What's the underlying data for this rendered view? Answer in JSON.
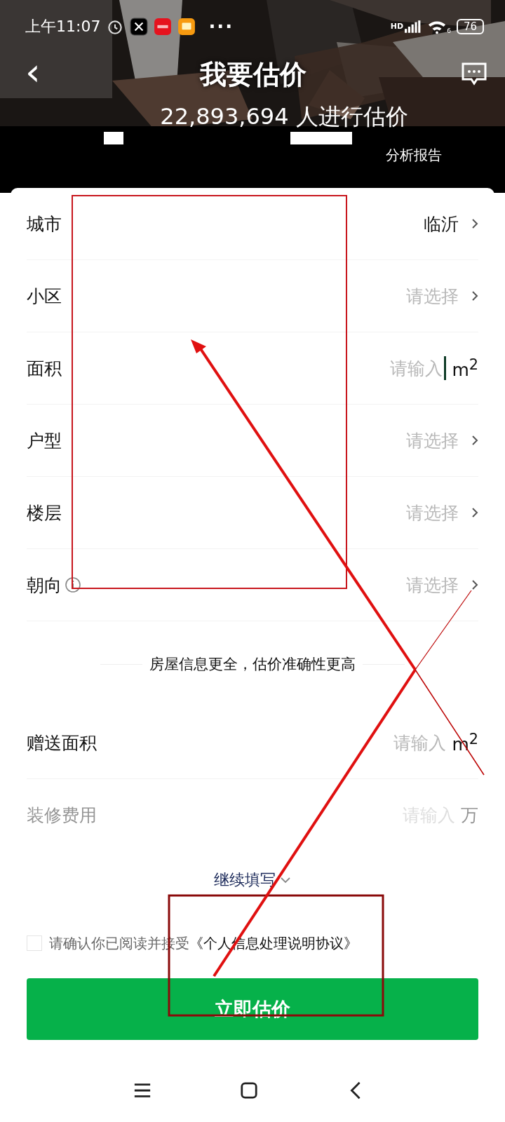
{
  "status_bar": {
    "time": "上午11:07",
    "more": "···",
    "network": "HD",
    "wifi_band": "6",
    "battery": "76"
  },
  "nav": {
    "back": "‹",
    "title": "我要估价"
  },
  "header": {
    "count_line": "22,893,694 人进行估价",
    "report_link": "分析报告"
  },
  "fields": [
    {
      "kind": "select",
      "label": "城市",
      "value": "临沂"
    },
    {
      "kind": "select",
      "label": "小区",
      "placeholder": "请选择"
    },
    {
      "kind": "input",
      "label": "面积",
      "placeholder": "请输入",
      "unit": "m$^{2}$",
      "focused": true
    },
    {
      "kind": "select",
      "label": "户型",
      "placeholder": "请选择"
    },
    {
      "kind": "select",
      "label": "楼层",
      "placeholder": "请选择"
    },
    {
      "kind": "select",
      "label": "朝向",
      "placeholder": "请选择",
      "info": true
    }
  ],
  "section_divider": "房屋信息更全，估价准确性更高",
  "extra_fields": [
    {
      "kind": "input",
      "label": "赠送面积",
      "placeholder": "请输入",
      "unit": "m$^{2}$",
      "faded": false
    },
    {
      "kind": "input",
      "label": "装修费用",
      "placeholder": "请输入",
      "unit": "万",
      "faded": true
    }
  ],
  "more_link": "继续填写",
  "agreement": {
    "checked": false,
    "text": "请确认你已阅读并接受",
    "link": "《个人信息处理说明协议》"
  },
  "submit_button": "立即估价"
}
